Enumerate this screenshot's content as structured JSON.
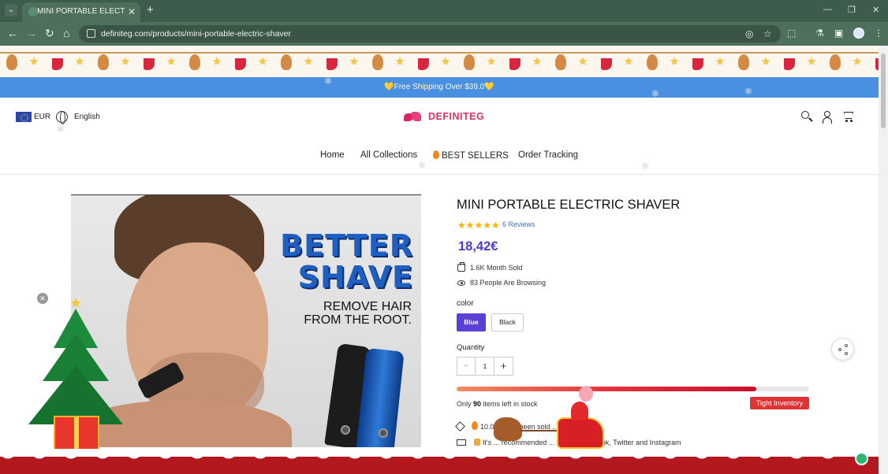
{
  "browser": {
    "tab_title": "MINI PORTABLE ELECTRIC SHAVER",
    "url": "definiteg.com/products/mini-portable-electric-shaver",
    "new_tab_symbol": "+",
    "tab_close_symbol": "✕"
  },
  "announcement": {
    "text": "💛Free Shipping Over $39.0💛"
  },
  "header": {
    "currency": "EUR",
    "language": "English",
    "brand": "DEFINITEG",
    "nav": [
      "Home",
      "All Collections",
      "BEST SELLERS",
      "Order Tracking"
    ]
  },
  "product_image": {
    "headline_line1": "BETTER",
    "headline_line2": "SHAVE",
    "tagline_line1": "REMOVE HAIR",
    "tagline_line2": "FROM THE ROOT."
  },
  "product": {
    "title": "MINI PORTABLE ELECTRIC SHAVER",
    "stars": "★★★★★",
    "rating": 5,
    "reviews": "6 Reviews",
    "price": "18,42€",
    "sold": "1.6K Month Sold",
    "browsing": "83 People Are Browsing",
    "option_label": "color",
    "options": [
      "Blue",
      "Black"
    ],
    "selected_option": "Blue",
    "quantity_label": "Quantity",
    "quantity": "1",
    "qty_minus": "−",
    "qty_plus": "+",
    "stock_prefix": "Only ",
    "stock_count": "90",
    "stock_suffix": " items left in stock",
    "stock_level": 0.85,
    "stock_badge": "Tight Inventory",
    "promo_sold": "10.0... have been sold ... !!",
    "promo_recommend": "It's ... recommended ... ple on Facebook, Twitter and Instagram"
  },
  "colors": {
    "accent": "#5b3fd6",
    "announcement_bg": "#4a90e2",
    "badge": "#e03434",
    "brand": "#d43265",
    "browser_chrome": "#4f6f5d"
  }
}
